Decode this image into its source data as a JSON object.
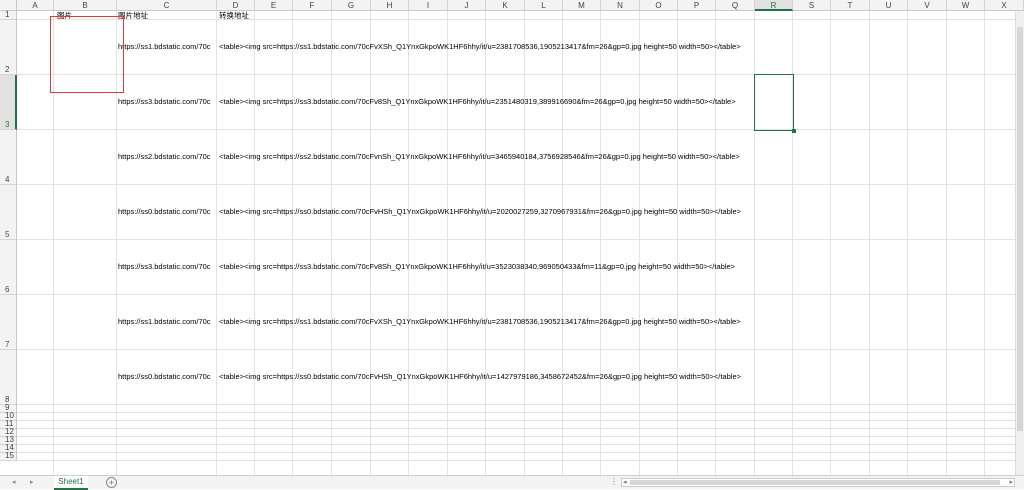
{
  "sheet": {
    "columns": [
      "A",
      "B",
      "C",
      "D",
      "E",
      "F",
      "G",
      "H",
      "I",
      "J",
      "K",
      "L",
      "M",
      "N",
      "O",
      "P",
      "Q",
      "R",
      "S",
      "T",
      "U",
      "V",
      "W",
      "X"
    ],
    "selected_column": "R",
    "rows": [
      "1",
      "2",
      "3",
      "4",
      "5",
      "6",
      "7",
      "8",
      "9",
      "10",
      "11",
      "12",
      "13",
      "14",
      "15"
    ],
    "selected_row": "3",
    "header": {
      "b1": "图片",
      "c1": "图片地址",
      "d1": "转换地址"
    },
    "data_rows": [
      {
        "c": "https://ss1.bdstatic.com/70c",
        "d": "<table><img src=https://ss1.bdstatic.com/70cFvXSh_Q1YnxGkpoWK1HF6hhy/it/u=2381708536,1905213417&fm=26&gp=0.jpg height=50 width=50></table>"
      },
      {
        "c": "https://ss3.bdstatic.com/70c",
        "d": "<table><img src=https://ss3.bdstatic.com/70cFv8Sh_Q1YnxGkpoWK1HF6hhy/it/u=2351480319,389916690&fm=26&gp=0.jpg height=50 width=50></table>"
      },
      {
        "c": "https://ss2.bdstatic.com/70c",
        "d": "<table><img src=https://ss2.bdstatic.com/70cFvnSh_Q1YnxGkpoWK1HF6hhy/it/u=3465940184,3756928546&fm=26&gp=0.jpg height=50 width=50></table>"
      },
      {
        "c": "https://ss0.bdstatic.com/70c",
        "d": "<table><img src=https://ss0.bdstatic.com/70cFvHSh_Q1YnxGkpoWK1HF6hhy/it/u=2020027259,3270967931&fm=26&gp=0.jpg height=50 width=50></table>"
      },
      {
        "c": "https://ss3.bdstatic.com/70c",
        "d": "<table><img src=https://ss3.bdstatic.com/70cFv8Sh_Q1YnxGkpoWK1HF6hhy/it/u=3523038340,969050433&fm=11&gp=0.jpg height=50 width=50></table>"
      },
      {
        "c": "https://ss1.bdstatic.com/70c",
        "d": "<table><img src=https://ss1.bdstatic.com/70cFvXSh_Q1YnxGkpoWK1HF6hhy/it/u=2381708536,1905213417&fm=26&gp=0.jpg height=50 width=50></table>"
      },
      {
        "c": "https://ss0.bdstatic.com/70c",
        "d": "<table><img src=https://ss0.bdstatic.com/70cFvHSh_Q1YnxGkpoWK1HF6hhy/it/u=1427979186,3458672452&fm=26&gp=0.jpg height=50 width=50></table>"
      }
    ]
  },
  "tabs": {
    "sheet1": "Sheet1",
    "add_icon": "plus-icon",
    "add_glyph": "+",
    "nav_prev": "◂",
    "nav_next": "▸",
    "scroll_left": "◂",
    "scroll_right": "▸",
    "dots": "⋮"
  },
  "colors": {
    "accent": "#217346",
    "image_frame": "#e03a3a"
  }
}
